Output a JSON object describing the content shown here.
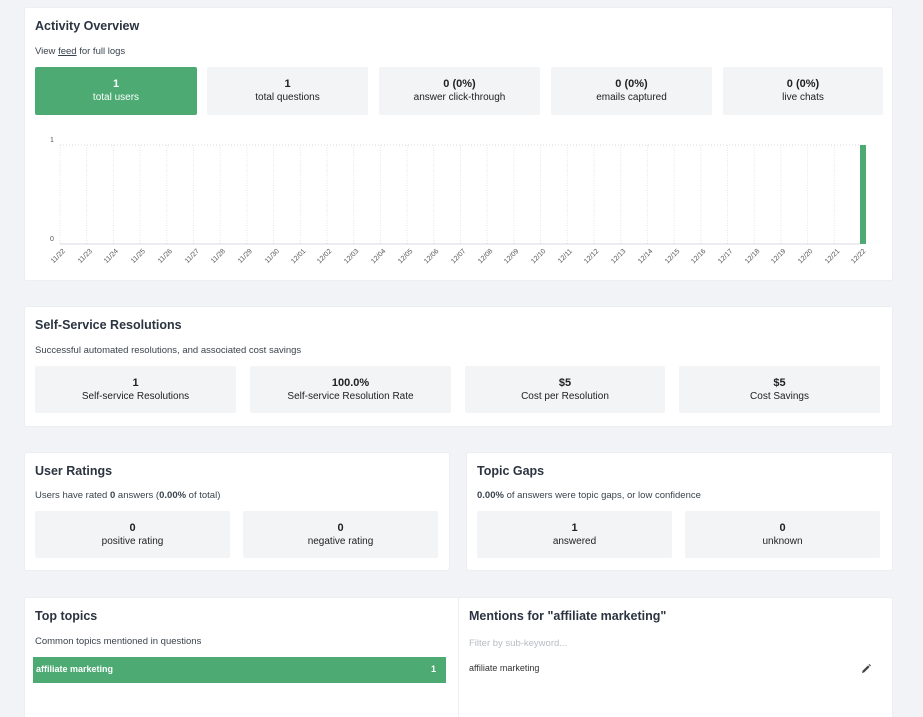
{
  "activity": {
    "title": "Activity Overview",
    "sub_pre": "View ",
    "sub_link": "feed",
    "sub_post": " for full logs",
    "stats": [
      {
        "value": "1",
        "label": "total users"
      },
      {
        "value": "1",
        "label": "total questions"
      },
      {
        "value": "0 (0%)",
        "label": "answer click-through"
      },
      {
        "value": "0 (0%)",
        "label": "emails captured"
      },
      {
        "value": "0 (0%)",
        "label": "live chats"
      }
    ]
  },
  "chart_data": {
    "type": "bar",
    "categories": [
      "11/22",
      "11/23",
      "11/24",
      "11/25",
      "11/26",
      "11/27",
      "11/28",
      "11/29",
      "11/30",
      "12/01",
      "12/02",
      "12/03",
      "12/04",
      "12/05",
      "12/06",
      "12/07",
      "12/08",
      "12/09",
      "12/10",
      "12/11",
      "12/12",
      "12/13",
      "12/14",
      "12/15",
      "12/16",
      "12/17",
      "12/18",
      "12/19",
      "12/20",
      "12/21",
      "12/22"
    ],
    "values": [
      0,
      0,
      0,
      0,
      0,
      0,
      0,
      0,
      0,
      0,
      0,
      0,
      0,
      0,
      0,
      0,
      0,
      0,
      0,
      0,
      0,
      0,
      0,
      0,
      0,
      0,
      0,
      0,
      0,
      0,
      1
    ],
    "yticks": [
      "1",
      "0"
    ],
    "ylim": [
      0,
      1
    ],
    "color": "#4caa72",
    "title": "",
    "xlabel": "",
    "ylabel": ""
  },
  "resolutions": {
    "title": "Self-Service Resolutions",
    "sub": "Successful automated resolutions, and associated cost savings",
    "stats": [
      {
        "value": "1",
        "label": "Self-service Resolutions"
      },
      {
        "value": "100.0%",
        "label": "Self-service Resolution Rate"
      },
      {
        "value": "$5",
        "label": "Cost per Resolution"
      },
      {
        "value": "$5",
        "label": "Cost Savings"
      }
    ]
  },
  "ratings": {
    "title": "User Ratings",
    "sub_a": "Users have rated ",
    "sub_b": "0",
    "sub_c": " answers (",
    "sub_d": "0.00%",
    "sub_e": " of total)",
    "stats": [
      {
        "value": "0",
        "label": "positive rating"
      },
      {
        "value": "0",
        "label": "negative rating"
      }
    ]
  },
  "gaps": {
    "title": "Topic Gaps",
    "sub_a": "0.00%",
    "sub_b": " of answers were topic gaps, or low confidence",
    "stats": [
      {
        "value": "1",
        "label": "answered"
      },
      {
        "value": "0",
        "label": "unknown"
      }
    ]
  },
  "topics": {
    "title": "Top topics",
    "sub": "Common topics mentioned in questions",
    "items": [
      {
        "name": "affiliate marketing",
        "count": "1"
      }
    ]
  },
  "mentions": {
    "title": "Mentions for \"affiliate marketing\"",
    "filter_placeholder": "Filter by sub-keyword...",
    "items": [
      "affiliate marketing"
    ],
    "edit_icon": "pencil-icon"
  },
  "colors": {
    "accent": "#4caa72",
    "stat_bg": "#f3f4f6",
    "page_bg": "#f2f3f7"
  }
}
